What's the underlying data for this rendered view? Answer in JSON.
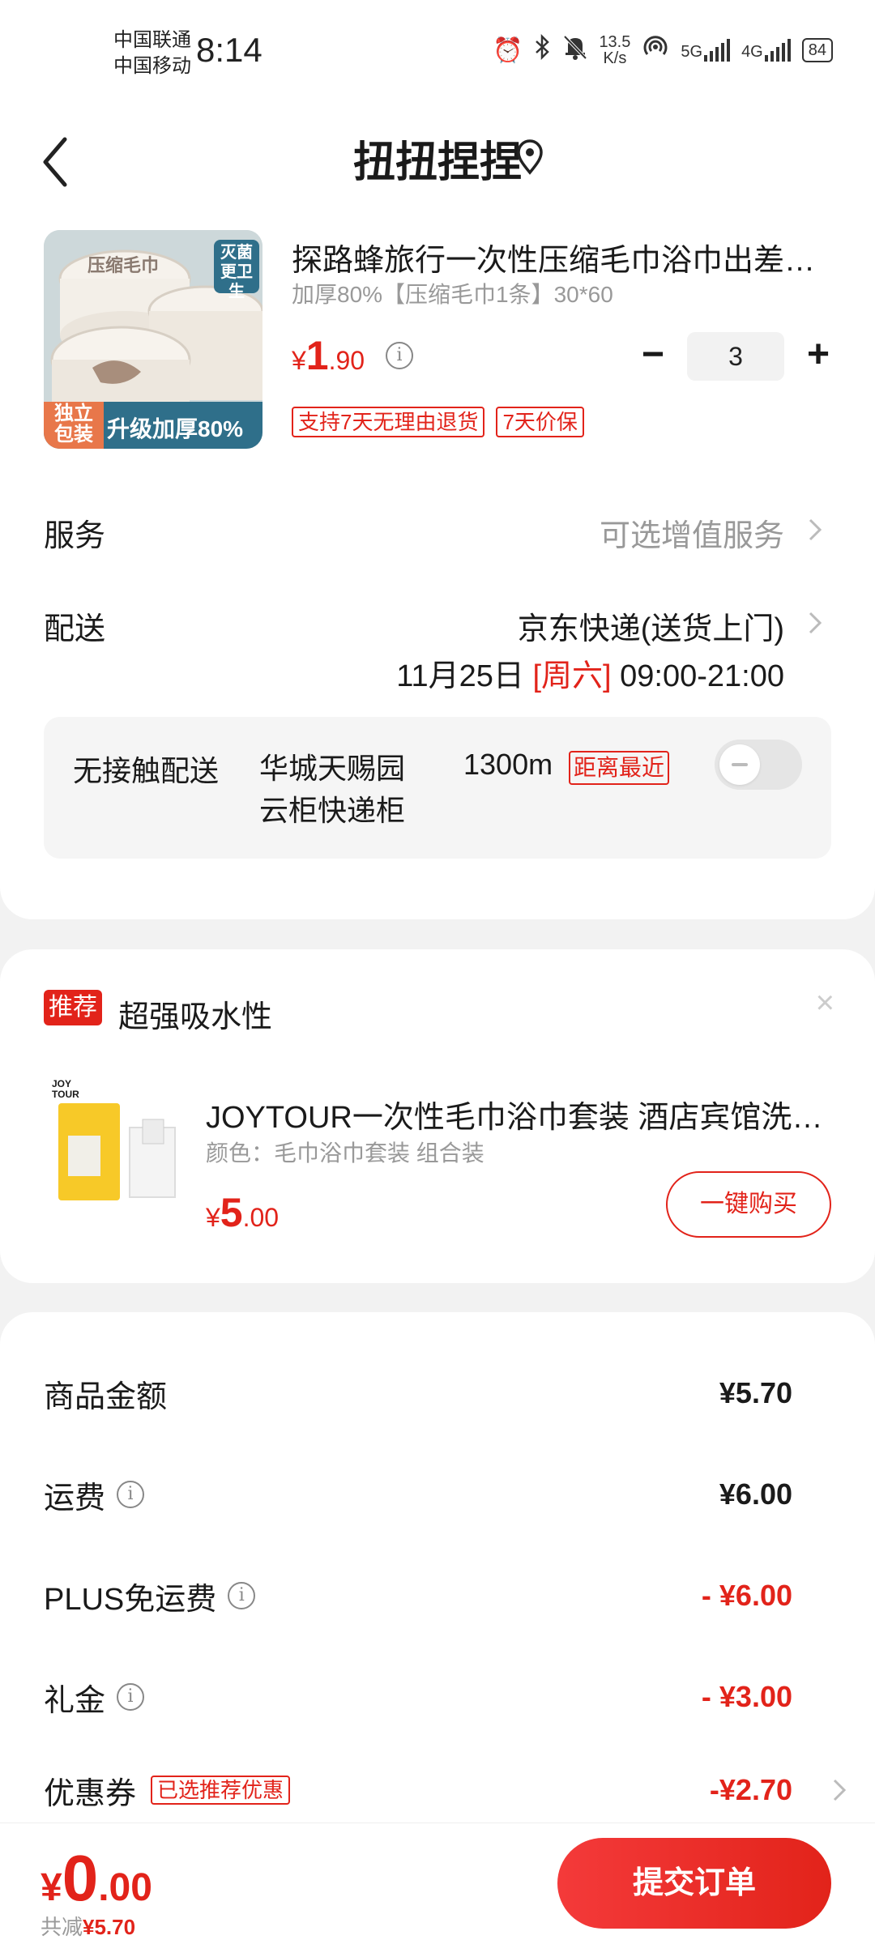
{
  "status_bar": {
    "carrier1": "中国联通",
    "carrier2": "中国移动",
    "time": "8:14",
    "net_speed_value": "13.5",
    "net_speed_unit": "K/s",
    "signal1_label": "5G",
    "signal2_label": "4G",
    "battery": "84"
  },
  "header": {
    "title": "扭扭捏捏",
    "back_icon": "chevron-left-icon",
    "location_icon": "location-pin-icon"
  },
  "product": {
    "image_badge_top": "灭菌更卫生",
    "image_badge_left": "独立包装",
    "image_banner": "升级加厚80%",
    "image_lid_text": "压缩毛巾",
    "title": "探路蜂旅行一次性压缩毛巾浴巾出差旅游酒店用品",
    "spec": "加厚80%【压缩毛巾1条】30*60",
    "price_yen": "¥",
    "price_int": "1",
    "price_dec": ".90",
    "quantity": "3",
    "minus_label": "−",
    "plus_label": "+",
    "tags": [
      "支持7天无理由退货",
      "7天价保"
    ]
  },
  "service": {
    "label": "服务",
    "value": "可选增值服务"
  },
  "delivery": {
    "label": "配送",
    "method": "京东快递(送货上门)",
    "date": "11月25日",
    "weekday": "[周六]",
    "time_range": "09:00-21:00"
  },
  "contactless": {
    "label": "无接触配送",
    "location_line1": "华城天赐园",
    "location_line2": "云柜快递柜",
    "distance": "1300m",
    "tag": "距离最近",
    "toggle_on": false
  },
  "recommend": {
    "badge": "推荐",
    "title": "超强吸水性",
    "close_label": "×",
    "product_brand_on_image": "JOY TOUR",
    "product_title": "JOYTOUR一次性毛巾浴巾套装 酒店宾馆洗浴用品",
    "product_spec": "颜色：毛巾浴巾套装 组合装",
    "price_yen": "¥",
    "price_int": "5",
    "price_dec": ".00",
    "buy_label": "一键购买"
  },
  "summary": {
    "rows": [
      {
        "label": "商品金额",
        "value": "¥5.70",
        "info": false,
        "red": false
      },
      {
        "label": "运费",
        "value": "¥6.00",
        "info": true,
        "red": false
      },
      {
        "label": "PLUS免运费",
        "value": "- ¥6.00",
        "info": true,
        "red": true
      },
      {
        "label": "礼金",
        "value": "- ¥3.00",
        "info": true,
        "red": true
      }
    ],
    "coupon_label": "优惠券",
    "coupon_tag": "已选推荐优惠",
    "coupon_value": "-¥2.70"
  },
  "bottom": {
    "total_yen": "¥",
    "total_int": "0",
    "total_dec": ".00",
    "savings_prefix": "共减",
    "savings_value": "¥5.70",
    "submit_label": "提交订单"
  },
  "colors": {
    "accent_red": "#e2231a",
    "background": "#f2f2f2"
  }
}
